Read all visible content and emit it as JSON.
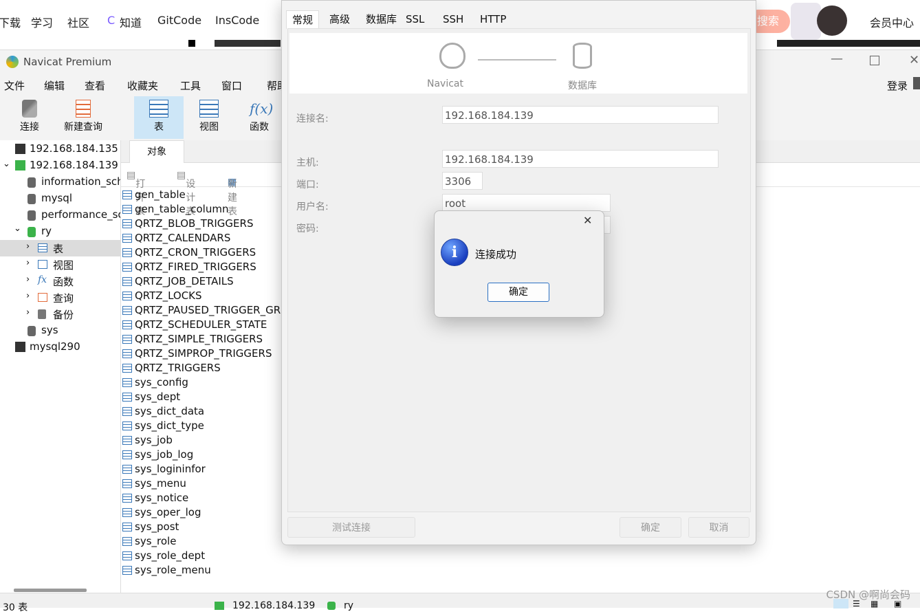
{
  "browser_nav": {
    "items": [
      "下载",
      "学习",
      "社区",
      "知道",
      "GitCode",
      "InsCode"
    ],
    "search_label": "搜索",
    "member_center": "会员中心"
  },
  "window": {
    "title": "Navicat Premium"
  },
  "menu": [
    "文件",
    "编辑",
    "查看",
    "收藏夹",
    "工具",
    "窗口",
    "帮助"
  ],
  "login_label": "登录",
  "toolbar": {
    "connect": "连接",
    "new_query": "新建查询",
    "table": "表",
    "view": "视图",
    "function": "函数"
  },
  "sidebar": {
    "connections": [
      {
        "label": "192.168.184.135"
      },
      {
        "label": "192.168.184.139"
      }
    ],
    "databases": [
      "information_schema",
      "mysql",
      "performance_schema",
      "ry"
    ],
    "ry_children": [
      "表",
      "视图",
      "函数",
      "查询",
      "备份"
    ],
    "sys_db": "sys",
    "other_connection": "mysql290"
  },
  "objects": {
    "tab": "对象",
    "tools": {
      "open": "打开表",
      "design": "设计表",
      "new": "新建表"
    },
    "tables": [
      "gen_table",
      "gen_table_column",
      "QRTZ_BLOB_TRIGGERS",
      "QRTZ_CALENDARS",
      "QRTZ_CRON_TRIGGERS",
      "QRTZ_FIRED_TRIGGERS",
      "QRTZ_JOB_DETAILS",
      "QRTZ_LOCKS",
      "QRTZ_PAUSED_TRIGGER_GRPS",
      "QRTZ_SCHEDULER_STATE",
      "QRTZ_SIMPLE_TRIGGERS",
      "QRTZ_SIMPROP_TRIGGERS",
      "QRTZ_TRIGGERS",
      "sys_config",
      "sys_dept",
      "sys_dict_data",
      "sys_dict_type",
      "sys_job",
      "sys_job_log",
      "sys_logininfor",
      "sys_menu",
      "sys_notice",
      "sys_oper_log",
      "sys_post",
      "sys_role",
      "sys_role_dept",
      "sys_role_menu"
    ]
  },
  "statusbar": {
    "count": "30 表",
    "connection": "192.168.184.139",
    "db": "ry"
  },
  "dialog": {
    "tabs": [
      "常规",
      "高级",
      "数据库",
      "SSL",
      "SSH",
      "HTTP"
    ],
    "banner_left": "Navicat",
    "banner_right": "数据库",
    "labels": {
      "conn_name": "连接名:",
      "host": "主机:",
      "port": "端口:",
      "user": "用户名:",
      "password": "密码:"
    },
    "values": {
      "conn_name": "192.168.184.139",
      "host": "192.168.184.139",
      "port": "3306",
      "user": "root"
    },
    "buttons": {
      "test": "测试连接",
      "ok": "确定",
      "cancel": "取消"
    }
  },
  "message_box": {
    "text": "连接成功",
    "ok": "确定",
    "close_glyph": "✕"
  },
  "watermark": "CSDN @啊尚会码"
}
